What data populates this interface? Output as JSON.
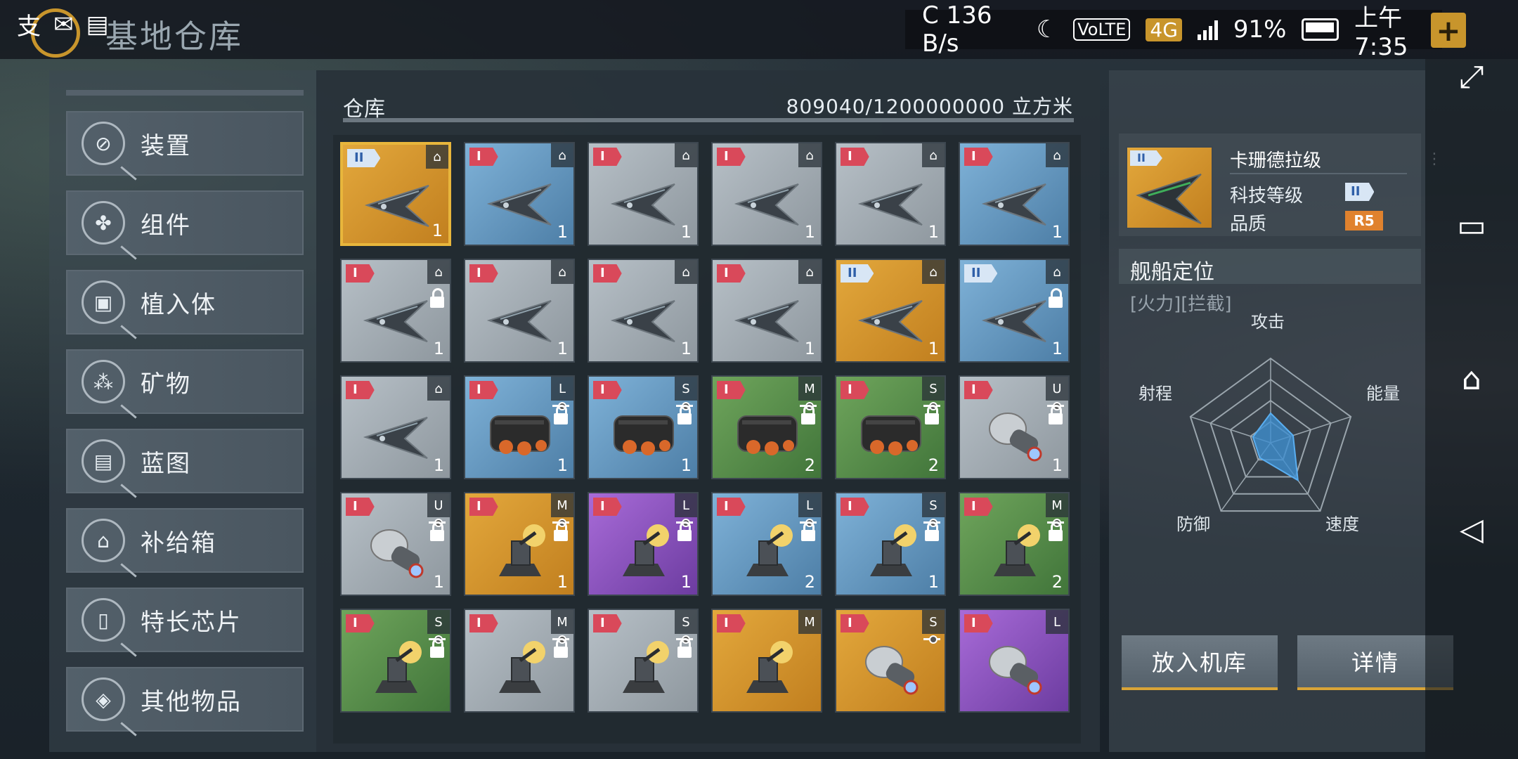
{
  "statusbar": {
    "left_icons": [
      "支",
      "消息",
      "图"
    ],
    "speed": "136 B/s",
    "network": "4G",
    "volte": "VoLTE",
    "battery": "91%",
    "time": "上午7:35"
  },
  "header": {
    "title": "基地仓库"
  },
  "sidebar": {
    "items": [
      {
        "label": "装置",
        "icon": "device-icon",
        "glyph": "⊘"
      },
      {
        "label": "组件",
        "icon": "puzzle-icon",
        "glyph": "✤"
      },
      {
        "label": "植入体",
        "icon": "implant-icon",
        "glyph": "▣"
      },
      {
        "label": "矿物",
        "icon": "mineral-icon",
        "glyph": "⁂"
      },
      {
        "label": "蓝图",
        "icon": "blueprint-icon",
        "glyph": "▤"
      },
      {
        "label": "补给箱",
        "icon": "supply-box-icon",
        "glyph": "⌂"
      },
      {
        "label": "特长芯片",
        "icon": "chip-icon",
        "glyph": "▯"
      },
      {
        "label": "其他物品",
        "icon": "cube-icon",
        "glyph": "◈"
      }
    ]
  },
  "storage": {
    "title": "仓库",
    "capacity": "809040/1200000000 立方米",
    "items": [
      {
        "tier": "II",
        "bg": "orange",
        "badge": "⌂",
        "qty": "1",
        "selected": true,
        "art": "ship"
      },
      {
        "tier": "I",
        "bg": "blue",
        "badge": "⌂",
        "qty": "1",
        "art": "ship"
      },
      {
        "tier": "I",
        "bg": "gray",
        "badge": "⌂",
        "qty": "1",
        "art": "ship"
      },
      {
        "tier": "I",
        "bg": "gray",
        "badge": "⌂",
        "qty": "1",
        "art": "ship"
      },
      {
        "tier": "I",
        "bg": "gray",
        "badge": "⌂",
        "qty": "1",
        "art": "ship"
      },
      {
        "tier": "I",
        "bg": "blue",
        "badge": "⌂",
        "qty": "1",
        "art": "ship"
      },
      {
        "tier": "I",
        "bg": "gray",
        "badge": "⌂",
        "qty": "1",
        "lock": true,
        "art": "ship"
      },
      {
        "tier": "I",
        "bg": "gray",
        "badge": "⌂",
        "qty": "1",
        "art": "ship"
      },
      {
        "tier": "I",
        "bg": "gray",
        "badge": "⌂",
        "qty": "1",
        "art": "ship"
      },
      {
        "tier": "I",
        "bg": "gray",
        "badge": "⌂",
        "qty": "1",
        "art": "ship"
      },
      {
        "tier": "II",
        "bg": "orange",
        "badge": "⌂",
        "qty": "1",
        "art": "ship"
      },
      {
        "tier": "II",
        "bg": "blue",
        "badge": "⌂",
        "qty": "1",
        "lock": true,
        "art": "ship"
      },
      {
        "tier": "I",
        "bg": "gray",
        "badge": "⌂",
        "qty": "1",
        "art": "ship"
      },
      {
        "tier": "I",
        "bg": "blue",
        "badge": "L",
        "qty": "1",
        "lock": true,
        "slider": true,
        "art": "engine"
      },
      {
        "tier": "I",
        "bg": "blue",
        "badge": "S",
        "qty": "1",
        "lock": true,
        "slider": true,
        "art": "engine"
      },
      {
        "tier": "I",
        "bg": "green",
        "badge": "M",
        "qty": "2",
        "lock": true,
        "slider": true,
        "art": "engine"
      },
      {
        "tier": "I",
        "bg": "green",
        "badge": "S",
        "qty": "2",
        "lock": true,
        "slider": true,
        "art": "engine"
      },
      {
        "tier": "I",
        "bg": "gray",
        "badge": "U",
        "qty": "1",
        "lock": true,
        "slider": true,
        "art": "canister"
      },
      {
        "tier": "I",
        "bg": "gray",
        "badge": "U",
        "qty": "1",
        "lock": true,
        "slider": true,
        "art": "canister"
      },
      {
        "tier": "I",
        "bg": "orange",
        "badge": "M",
        "qty": "1",
        "lock": true,
        "slider": true,
        "art": "turret"
      },
      {
        "tier": "I",
        "bg": "purple",
        "badge": "L",
        "qty": "1",
        "lock": true,
        "slider": true,
        "art": "turret"
      },
      {
        "tier": "I",
        "bg": "blue",
        "badge": "L",
        "qty": "2",
        "lock": true,
        "slider": true,
        "art": "turret"
      },
      {
        "tier": "I",
        "bg": "blue",
        "badge": "S",
        "qty": "1",
        "lock": true,
        "slider": true,
        "art": "turret"
      },
      {
        "tier": "I",
        "bg": "green",
        "badge": "M",
        "qty": "2",
        "lock": true,
        "slider": true,
        "art": "turret"
      },
      {
        "tier": "I",
        "bg": "green",
        "badge": "S",
        "qty": "",
        "lock": true,
        "slider": true,
        "art": "turret"
      },
      {
        "tier": "I",
        "bg": "gray",
        "badge": "M",
        "qty": "",
        "lock": true,
        "slider": true,
        "art": "turret"
      },
      {
        "tier": "I",
        "bg": "gray",
        "badge": "S",
        "qty": "",
        "lock": true,
        "slider": true,
        "art": "turret"
      },
      {
        "tier": "I",
        "bg": "orange",
        "badge": "M",
        "qty": "",
        "art": "turret"
      },
      {
        "tier": "I",
        "bg": "orange",
        "badge": "S",
        "qty": "",
        "slider": true,
        "art": "canister"
      },
      {
        "tier": "I",
        "bg": "purple",
        "badge": "L",
        "qty": "",
        "art": "canister"
      }
    ]
  },
  "detail": {
    "thumb_tier": "II",
    "ship_name": "卡珊德拉级",
    "tech_label": "科技等级",
    "tech_value": "II",
    "quality_label": "品质",
    "quality_value": "R5",
    "role_title": "舰船定位",
    "role_tags": "[火力][拦截]",
    "radar": {
      "axes": [
        "攻击",
        "能量",
        "速度",
        "防御",
        "射程"
      ],
      "values": [
        0.35,
        0.28,
        0.55,
        0.22,
        0.22
      ]
    },
    "buttons": {
      "hangar": "放入机库",
      "details": "详情"
    }
  },
  "colors": {
    "accent": "#d9a437",
    "tier1": "#d9495a",
    "tier2": "#d8e6f5",
    "radar_fill": "#3f8fd0"
  }
}
